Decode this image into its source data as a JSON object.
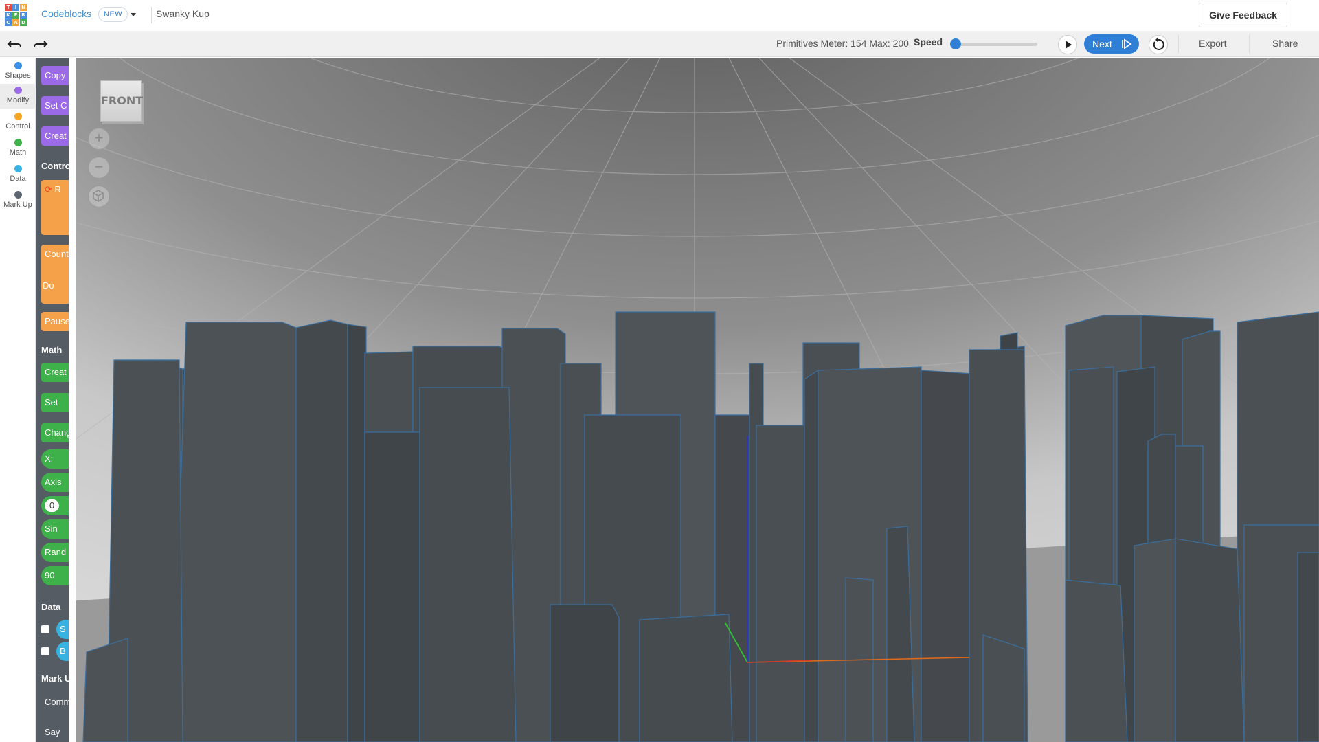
{
  "header": {
    "logo_letters": [
      "T",
      "I",
      "N",
      "K",
      "E",
      "R",
      "C",
      "A",
      "D"
    ],
    "app_name": "Codeblocks",
    "new_badge": "NEW",
    "project_name": "Swanky Kup",
    "feedback_label": "Give Feedback"
  },
  "toolbar": {
    "meter_text": "Primitives Meter: 154 Max: 200",
    "speed_label": "Speed",
    "speed_value": 0,
    "next_label": "Next",
    "export_label": "Export",
    "share_label": "Share"
  },
  "categories": [
    {
      "label": "Shapes",
      "color": "#3a8fe6"
    },
    {
      "label": "Modify",
      "color": "#9b6ae6"
    },
    {
      "label": "Control",
      "color": "#f5a623"
    },
    {
      "label": "Math",
      "color": "#3fb14a"
    },
    {
      "label": "Data",
      "color": "#38b2e0"
    },
    {
      "label": "Mark Up",
      "color": "#5b6470"
    }
  ],
  "flyout": {
    "blocks": {
      "copy": "Copy",
      "set_c": "Set C",
      "create_modify": "Creat",
      "control_section": "Contro",
      "repeat": "R",
      "count": "Count",
      "do": "Do",
      "pause": "Pause",
      "math_section": "Math",
      "create_math": "Creat",
      "set": "Set",
      "change": "Chang",
      "x": "X:",
      "axis": "Axis",
      "zero": "0",
      "sin": "Sin",
      "random": "Rand",
      "ninety": "90",
      "data_section": "Data",
      "data1": "S",
      "data2": "B",
      "markup_section": "Mark U",
      "comment": "Comm",
      "say": "Say"
    }
  },
  "viewport": {
    "view_cube_label": "FRONT",
    "zoom_in": "+",
    "zoom_out": "−"
  },
  "colors": {
    "accent": "#2f7fd6",
    "building": "#4a4f54",
    "building_edge": "#3b6e9c"
  }
}
